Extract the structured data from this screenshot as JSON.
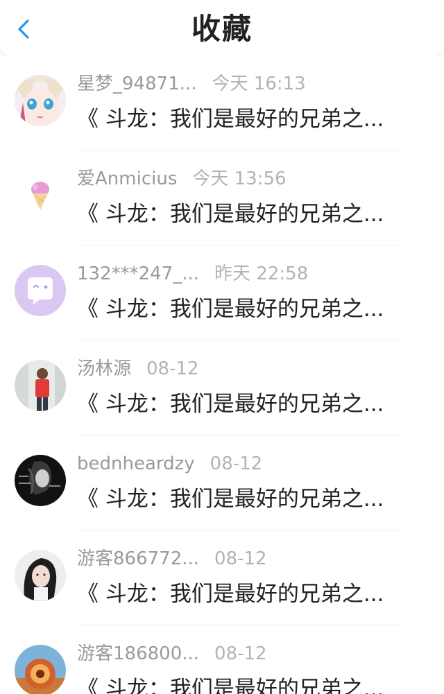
{
  "header": {
    "title": "收藏",
    "back_icon": "chevron-left-icon",
    "accent_color": "#2196f3"
  },
  "items": [
    {
      "username": "星梦_94871...",
      "time": "今天 16:13",
      "title": "《 斗龙：我们是最好的兄弟之...",
      "avatar": "anime-girl-avatar"
    },
    {
      "username": "爱Anmicius",
      "time": "今天 13:56",
      "title": "《 斗龙：我们是最好的兄弟之...",
      "avatar": "ice-cream-avatar"
    },
    {
      "username": "132***247_...",
      "time": "昨天 22:58",
      "title": "《 斗龙：我们是最好的兄弟之...",
      "avatar": "default-chat-avatar"
    },
    {
      "username": "汤林源",
      "time": "08-12",
      "title": "《 斗龙：我们是最好的兄弟之...",
      "avatar": "boy-photo-avatar"
    },
    {
      "username": "bednheardzy",
      "time": "08-12",
      "title": "《 斗龙：我们是最好的兄弟之...",
      "avatar": "dark-portrait-avatar"
    },
    {
      "username": "游客866772...",
      "time": "08-12",
      "title": "《 斗龙：我们是最好的兄弟之...",
      "avatar": "girl-portrait-avatar"
    },
    {
      "username": "游客186800...",
      "time": "08-12",
      "title": "《 斗龙：我们是最好的兄弟之...",
      "avatar": "ornament-avatar"
    }
  ]
}
